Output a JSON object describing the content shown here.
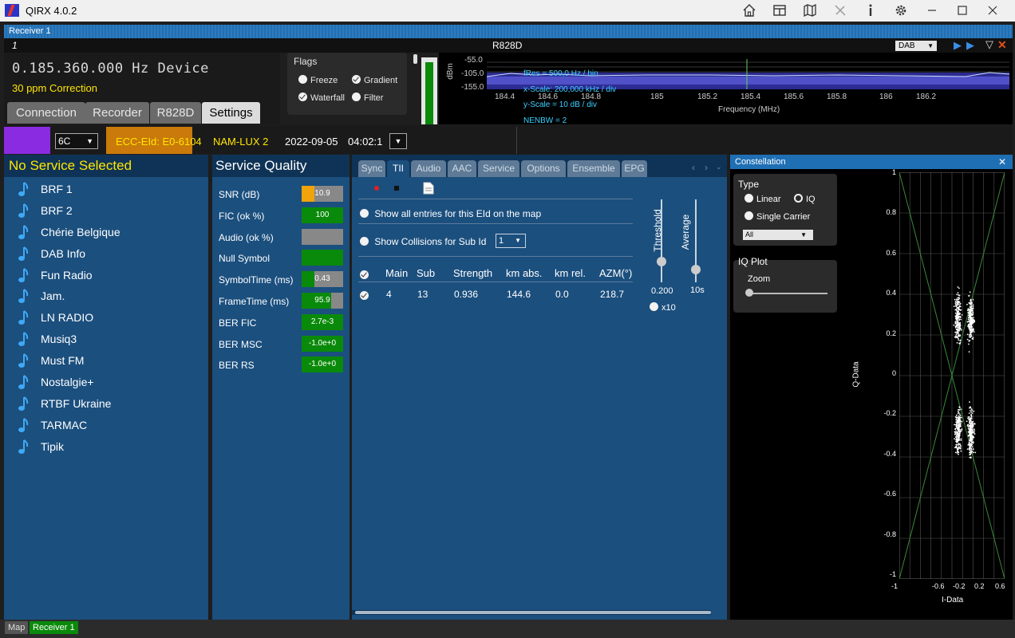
{
  "app": {
    "title": "QIRX 4.0.2"
  },
  "receiver": {
    "header": "Receiver 1",
    "index": "1",
    "device_name": "R828D",
    "mode": "DAB"
  },
  "freq": {
    "display": "0.185.360.000 Hz Device",
    "correction": "30 ppm Correction"
  },
  "top_tabs": [
    {
      "label": "Connection"
    },
    {
      "label": "Recorder"
    },
    {
      "label": "R828D"
    },
    {
      "label": "Settings"
    }
  ],
  "flags": {
    "title": "Flags",
    "freeze": "Freeze",
    "gradient": "Gradient",
    "waterfall": "Waterfall",
    "filter": "Filter"
  },
  "spectrum": {
    "y_unit": "dBm",
    "y_ticks": [
      "-55.0",
      "-105.0",
      "-155.0"
    ],
    "x_ticks": [
      "184.4",
      "184.6",
      "184.8",
      "185",
      "185.2",
      "185.4",
      "185.6",
      "185.8",
      "186",
      "186.2"
    ],
    "x_label": "Frequency (MHz)",
    "info": [
      "fRes = 500,0 Hz / bin",
      "x-Scale: 200,000 kHz / div",
      "y-Scale = 10 dB / div",
      "NENBW = 2"
    ]
  },
  "station": {
    "channel": "6C",
    "ecc": "ECC-EId: E0-6104",
    "ensemble": "NAM-LUX 2",
    "date": "2022-09-05",
    "time": "04:02:1"
  },
  "services": {
    "header": "No Service Selected",
    "items": [
      "BRF 1",
      "BRF 2",
      "Chérie Belgique",
      "DAB Info",
      "Fun Radio",
      "Jam.",
      "LN RADIO",
      "Musiq3",
      "Must FM",
      "Nostalgie+",
      "RTBF Ukraine",
      "TARMAC",
      "Tipik"
    ]
  },
  "quality": {
    "header": "Service Quality",
    "rows": [
      {
        "label": "SNR (dB)",
        "value": "10.9",
        "fill": 0.3,
        "color": "#f0a30a"
      },
      {
        "label": "FIC (ok %)",
        "value": "100",
        "fill": 1.0,
        "color": "#0a8a0a"
      },
      {
        "label": "Audio (ok %)",
        "value": "",
        "fill": 0.0,
        "color": "#0a8a0a"
      },
      {
        "label": "Null Symbol",
        "value": "",
        "fill": 1.0,
        "color": "#0a8a0a"
      },
      {
        "label": "SymbolTime (ms)",
        "value": "0.43",
        "fill": 0.3,
        "color": "#0a8a0a"
      },
      {
        "label": "FrameTime (ms)",
        "value": "95.9",
        "fill": 0.72,
        "color": "#0a8a0a"
      },
      {
        "label": "BER FIC",
        "value": "2.7e-3",
        "fill": 1.0,
        "color": "#0a8a0a"
      },
      {
        "label": "BER MSC",
        "value": "-1.0e+0",
        "fill": 1.0,
        "color": "#0a8a0a"
      },
      {
        "label": "BER RS",
        "value": "-1.0e+0",
        "fill": 1.0,
        "color": "#0a8a0a"
      }
    ]
  },
  "tii": {
    "tabs": [
      "Sync",
      "TII",
      "Audio",
      "AAC",
      "Service",
      "Options",
      "Ensemble",
      "EPG"
    ],
    "active_tab": "TII",
    "show_all": "Show all entries for this EId on the map",
    "show_collisions": "Show Collisions for Sub Id",
    "sub_id": "1",
    "columns": [
      "Main",
      "Sub",
      "Strength",
      "km abs.",
      "km rel.",
      "AZM(°)"
    ],
    "rows": [
      [
        "4",
        "13",
        "0.936",
        "144.6",
        "0.0",
        "218.7"
      ]
    ],
    "threshold_label": "Threshold",
    "threshold_value": "0.200",
    "average_label": "Average",
    "average_value": "10s",
    "x10": "x10"
  },
  "constellation": {
    "header": "Constellation",
    "type_title": "Type",
    "linear": "Linear",
    "iq": "IQ",
    "single_carrier": "Single Carrier",
    "carrier_select": "All",
    "iq_plot_title": "IQ Plot",
    "zoom": "Zoom",
    "y_label": "Q-Data",
    "x_label": "I-Data",
    "y_ticks": [
      "1",
      "0.8",
      "0.6",
      "0.4",
      "0.2",
      "0",
      "-0.2",
      "-0.4",
      "-0.6",
      "-0.8",
      "-1"
    ],
    "x_ticks": [
      "-1",
      "-0.6",
      "-0.2",
      "0.2",
      "0.6"
    ]
  },
  "status_bar": {
    "map": "Map",
    "receiver": "Receiver 1"
  },
  "colors": {
    "accent": "#1f6fb5",
    "panel": "#1b4f7e",
    "header": "#0f3356",
    "yellow": "#ffe600",
    "orange": "#f0a30a",
    "green": "#0a8a0a"
  }
}
